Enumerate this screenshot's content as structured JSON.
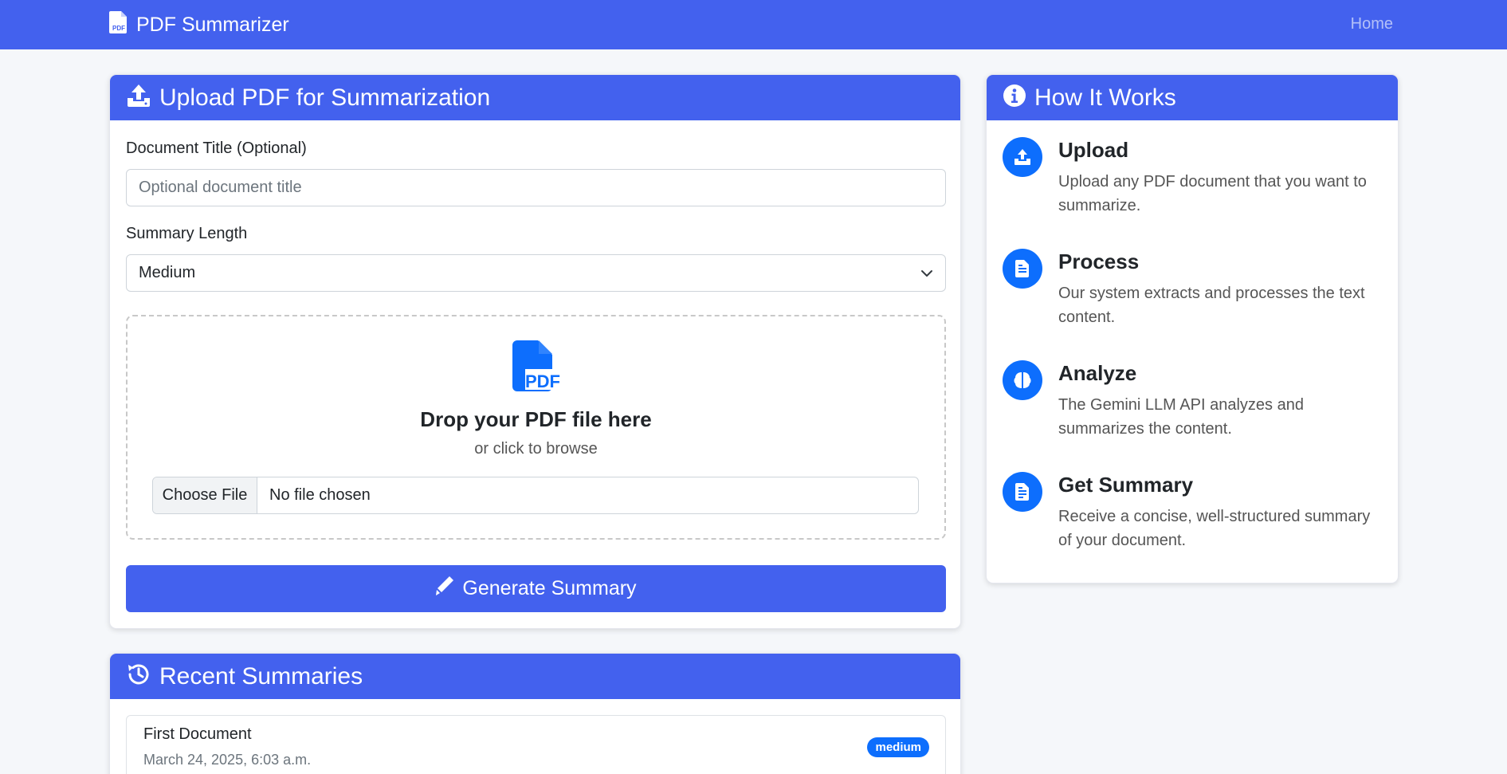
{
  "navbar": {
    "brand": "PDF Summarizer",
    "home_link": "Home"
  },
  "upload_card": {
    "title": "Upload PDF for Summarization",
    "doc_title_label": "Document Title (Optional)",
    "doc_title_placeholder": "Optional document title",
    "summary_length_label": "Summary Length",
    "summary_length_value": "Medium",
    "drop_title": "Drop your PDF file here",
    "drop_subtitle": "or click to browse",
    "choose_file_label": "Choose File",
    "no_file_text": "No file chosen",
    "generate_button": "Generate Summary"
  },
  "how_it_works": {
    "title": "How It Works",
    "steps": [
      {
        "title": "Upload",
        "desc": "Upload any PDF document that you want to summarize.",
        "icon": "upload-icon"
      },
      {
        "title": "Process",
        "desc": "Our system extracts and processes the text content.",
        "icon": "file-text-icon"
      },
      {
        "title": "Analyze",
        "desc": "The Gemini LLM API analyzes and summarizes the content.",
        "icon": "brain-icon"
      },
      {
        "title": "Get Summary",
        "desc": "Receive a concise, well-structured summary of your document.",
        "icon": "file-lines-icon"
      }
    ]
  },
  "recent": {
    "title": "Recent Summaries",
    "items": [
      {
        "title": "First Document",
        "date": "March 24, 2025, 6:03 a.m.",
        "badge": "medium"
      }
    ]
  },
  "colors": {
    "primary": "#4361ee",
    "accent_blue": "#0d6efd",
    "background": "#f5f7fa"
  }
}
